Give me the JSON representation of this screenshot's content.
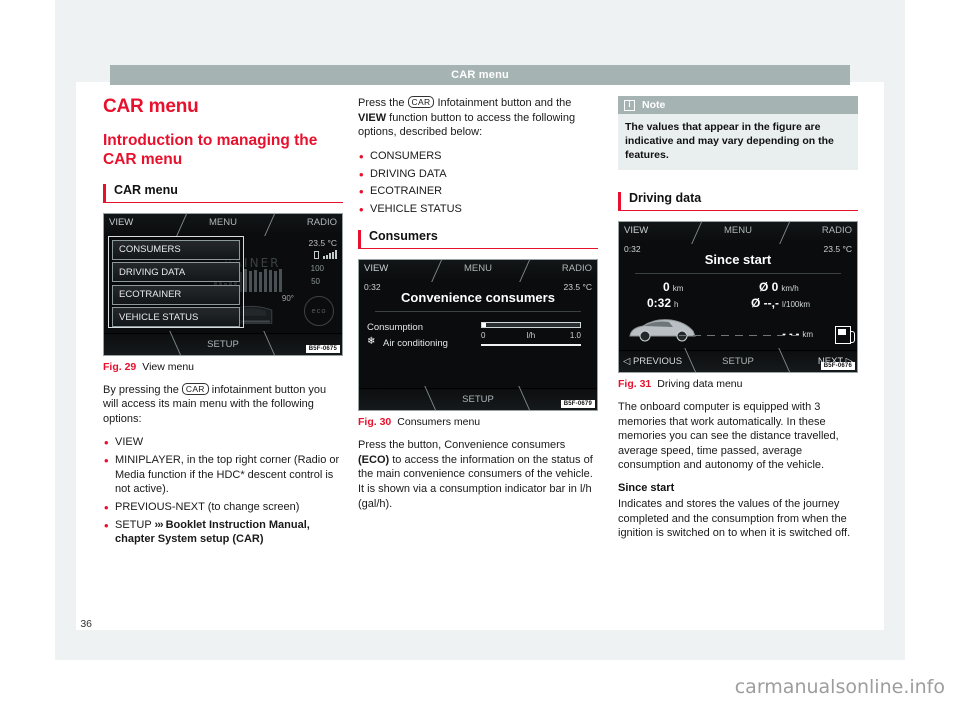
{
  "header": {
    "running_title": "CAR menu"
  },
  "folio": {
    "page_number": "36"
  },
  "watermark": {
    "text": "carmanualsonline.info"
  },
  "col1": {
    "chapter_title": "CAR menu",
    "section_title": "Introduction to managing the CAR menu",
    "subheading": "CAR menu",
    "figure": {
      "caption_label": "Fig. 29",
      "caption_text": "View menu",
      "code": "B5F-0675",
      "top_tabs": {
        "left": "VIEW",
        "center": "MENU",
        "right": "RADIO"
      },
      "bottom_tabs": {
        "center": "SETUP"
      },
      "menu_items": [
        "CONSUMERS",
        "DRIVING DATA",
        "ECOTRAINER",
        "VEHICLE STATUS"
      ],
      "ghost_text": "RAINER",
      "temperature": "23.5 °C",
      "scale_high": "100",
      "scale_low": "50",
      "angle": "90°",
      "eco_badge": "eco"
    },
    "intro_p1_a": "By pressing the ",
    "intro_key": "CAR",
    "intro_p1_b": " infotainment button you will access its main menu with the following options:",
    "bullets": [
      "VIEW",
      "MINIPLAYER, in the top right corner (Radio or Media function if the HDC* descent control is not active).",
      "PREVIOUS-NEXT (to change screen)",
      "SETUP"
    ],
    "setup_ref_arrows": "›››",
    "setup_ref_bold": "Booklet Instruction Manual, chapter System setup (CAR)"
  },
  "col2": {
    "intro_a": "Press the ",
    "intro_key": "CAR",
    "intro_b": " Infotainment button and the ",
    "intro_bold": "VIEW",
    "intro_c": " function button to access the following options, described below:",
    "bullets": [
      "CONSUMERS",
      "DRIVING DATA",
      "ECOTRAINER",
      "VEHICLE STATUS"
    ],
    "subheading": "Consumers",
    "figure": {
      "caption_label": "Fig. 30",
      "caption_text": "Consumers menu",
      "code": "B5F-0679",
      "top_tabs": {
        "left": "VIEW",
        "center": "MENU",
        "right": "RADIO"
      },
      "bottom_tabs": {
        "center": "SETUP"
      },
      "clock": "0:32",
      "temperature": "23.5 °C",
      "title": "Convenience consumers",
      "row1_label": "Consumption",
      "row2_label": "Air conditioning",
      "gauge_min": "0",
      "gauge_unit": "l/h",
      "gauge_max": "1.0"
    },
    "body_a": "Press the button, Convenience consumers ",
    "body_bold": "(ECO)",
    "body_b": " to access the information on the status of the main convenience consumers of the vehicle. It is shown via a consumption indicator bar in l/h (gal/h)."
  },
  "col3": {
    "note": {
      "title": "Note",
      "icon": "info-icon",
      "text": "The values that appear in the figure are indicative and may vary depending on the features."
    },
    "subheading": "Driving data",
    "figure": {
      "caption_label": "Fig. 31",
      "caption_text": "Driving data menu",
      "code": "B5F-0676",
      "top_tabs": {
        "left": "VIEW",
        "center": "MENU",
        "right": "RADIO"
      },
      "bottom_tabs": {
        "left": "◁ PREVIOUS",
        "center": "SETUP",
        "right": "NEXT ▷"
      },
      "clock": "0:32",
      "temperature": "23.5 °C",
      "title": "Since start",
      "distance_value": "0",
      "distance_unit": "km",
      "time_value": "0:32",
      "time_unit": "h",
      "avg_speed_value": "Ø 0",
      "avg_speed_unit": "km/h",
      "avg_cons_value": "Ø --,-",
      "avg_cons_unit": "l/100km",
      "range_value": "- - -",
      "range_unit": "km"
    },
    "body_1": "The onboard computer is equipped with 3 memories that work automatically. In these memories you can see the distance travelled, average speed, time passed, average consumption and autonomy of the vehicle.",
    "heading_since_start": "Since start",
    "body_2": "Indicates and stores the values of the journey completed and the consumption from when the ignition is switched on to when it is switched off."
  },
  "colors": {
    "accent_red": "#e8112d",
    "header_band": "#a6b3b3",
    "note_bg": "#e9eeee",
    "page_bg": "#eef2f2"
  }
}
